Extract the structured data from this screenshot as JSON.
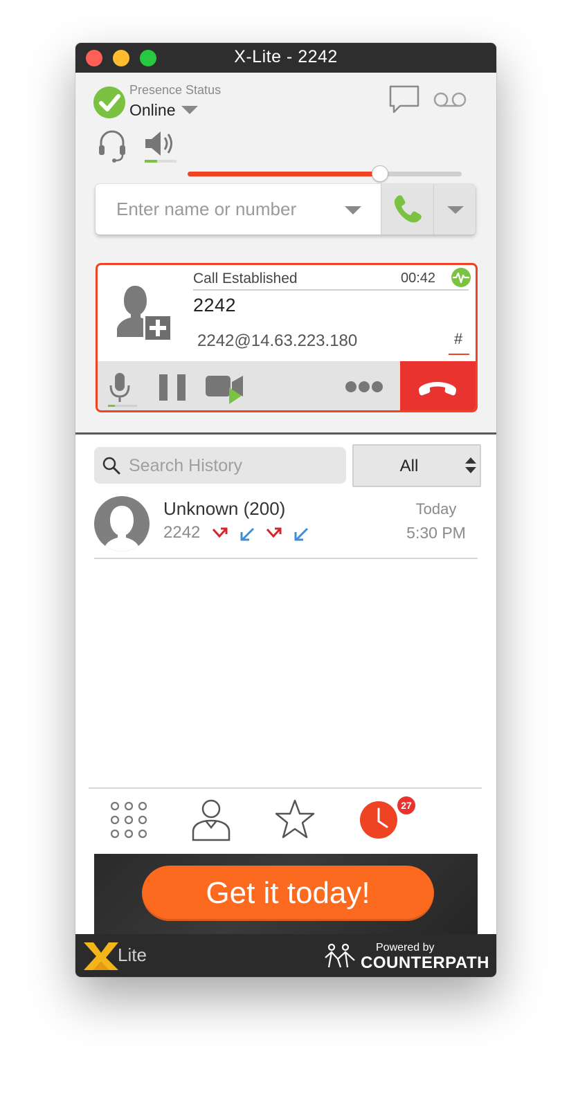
{
  "window": {
    "title": "X-Lite - 2242"
  },
  "presence": {
    "label": "Presence Status",
    "value": "Online"
  },
  "volume": {
    "level": 0.7
  },
  "dialer": {
    "placeholder": "Enter name or number",
    "value": ""
  },
  "call": {
    "status": "Call Established",
    "timer": "00:42",
    "number": "2242",
    "address": "2242@14.63.223.180",
    "keypad_symbol": "#"
  },
  "history": {
    "search_placeholder": "Search History",
    "filter_value": "All",
    "items": [
      {
        "name": "Unknown (200)",
        "number": "2242",
        "day": "Today",
        "time": "5:30 PM"
      }
    ]
  },
  "nav": {
    "badge_count": "27"
  },
  "ad": {
    "label": "Get it today!"
  },
  "footer": {
    "app_name": "Lite",
    "powered_by": "Powered by",
    "brand": "COUNTERPATH"
  },
  "colors": {
    "accent": "#ee4424",
    "online": "#7cc242",
    "hangup": "#e9332f",
    "ad_button": "#fb6a1f",
    "outgoing_arrow": "#d7262b",
    "incoming_arrow": "#3e8fd6"
  }
}
